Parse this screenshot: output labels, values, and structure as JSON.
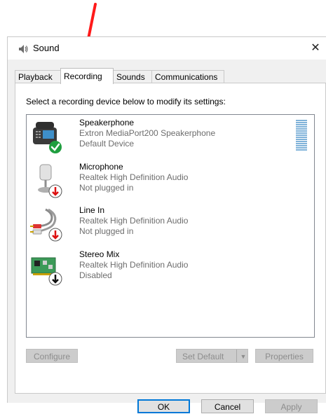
{
  "window": {
    "title": "Sound",
    "close_glyph": "✕"
  },
  "tabs": [
    {
      "label": "Playback",
      "active": false
    },
    {
      "label": "Recording",
      "active": true
    },
    {
      "label": "Sounds",
      "active": false
    },
    {
      "label": "Communications",
      "active": false
    }
  ],
  "instruction": "Select a recording device below to modify its settings:",
  "devices": [
    {
      "name": "Speakerphone",
      "driver": "Extron MediaPort200 Speakerphone",
      "status": "Default Device",
      "icon": "speakerphone-icon",
      "badge": "green-check-badge",
      "level_indicator": true
    },
    {
      "name": "Microphone",
      "driver": "Realtek High Definition Audio",
      "status": "Not plugged in",
      "icon": "microphone-icon",
      "badge": "red-down-arrow-badge",
      "level_indicator": false
    },
    {
      "name": "Line In",
      "driver": "Realtek High Definition Audio",
      "status": "Not plugged in",
      "icon": "line-in-cable-icon",
      "badge": "red-down-arrow-badge",
      "level_indicator": false
    },
    {
      "name": "Stereo Mix",
      "driver": "Realtek High Definition Audio",
      "status": "Disabled",
      "icon": "sound-card-icon",
      "badge": "black-down-arrow-badge",
      "level_indicator": false
    }
  ],
  "buttons": {
    "configure": "Configure",
    "set_default": "Set Default",
    "set_default_arrow": "▼",
    "properties": "Properties",
    "ok": "OK",
    "cancel": "Cancel",
    "apply": "Apply"
  },
  "annotation": {
    "icon": "red-arrow-icon",
    "color": "#ff0000"
  }
}
